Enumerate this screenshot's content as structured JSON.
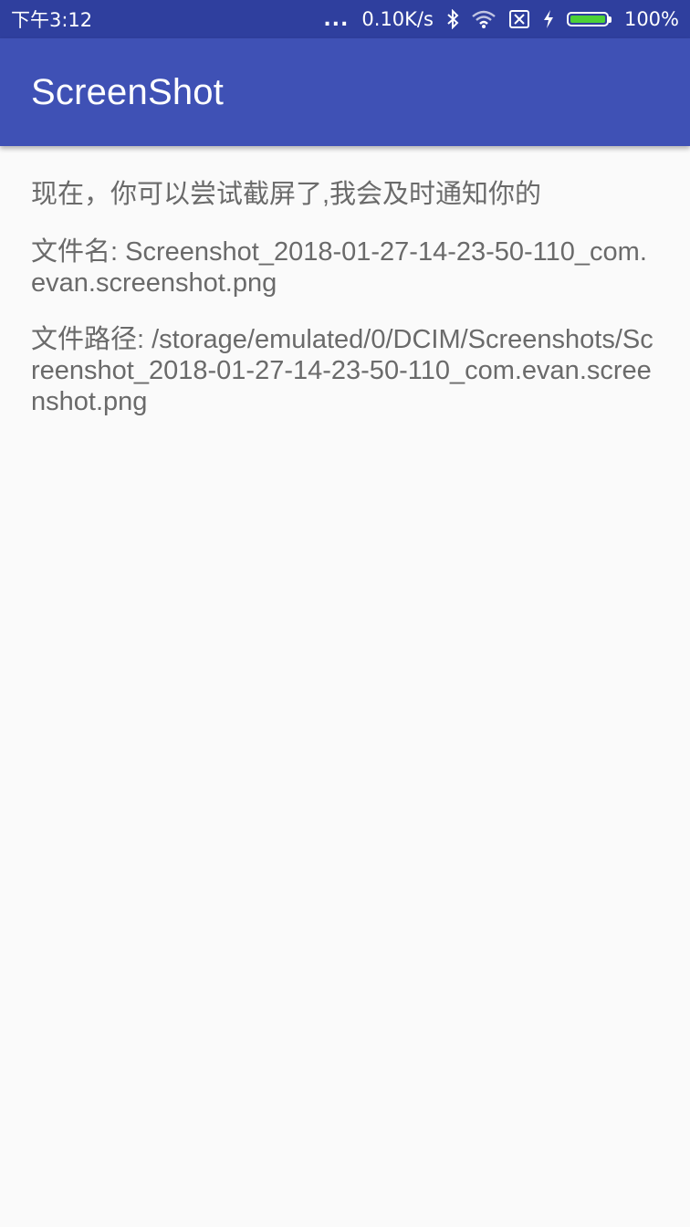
{
  "status_bar": {
    "time": "下午3:12",
    "dots": "...",
    "network_speed": "0.10K/s",
    "icons": [
      "bluetooth-icon",
      "wifi-icon",
      "sim-off-icon",
      "charging-icon"
    ],
    "battery_level": 1.0,
    "battery_text": "100%",
    "background_color": "#2f3f9e"
  },
  "app_bar": {
    "title": "ScreenShot",
    "background_color": "#3f51b5"
  },
  "main": {
    "message": "现在，你可以尝试截屏了,我会及时通知你的",
    "file_name_line": "文件名: Screenshot_2018-01-27-14-23-50-110_com.evan.screenshot.png",
    "file_path_line": "文件路径: /storage/emulated/0/DCIM/Screenshots/Screenshot_2018-01-27-14-23-50-110_com.evan.screenshot.png",
    "text_color": "#6a6a6a",
    "background_color": "#fafafa"
  }
}
